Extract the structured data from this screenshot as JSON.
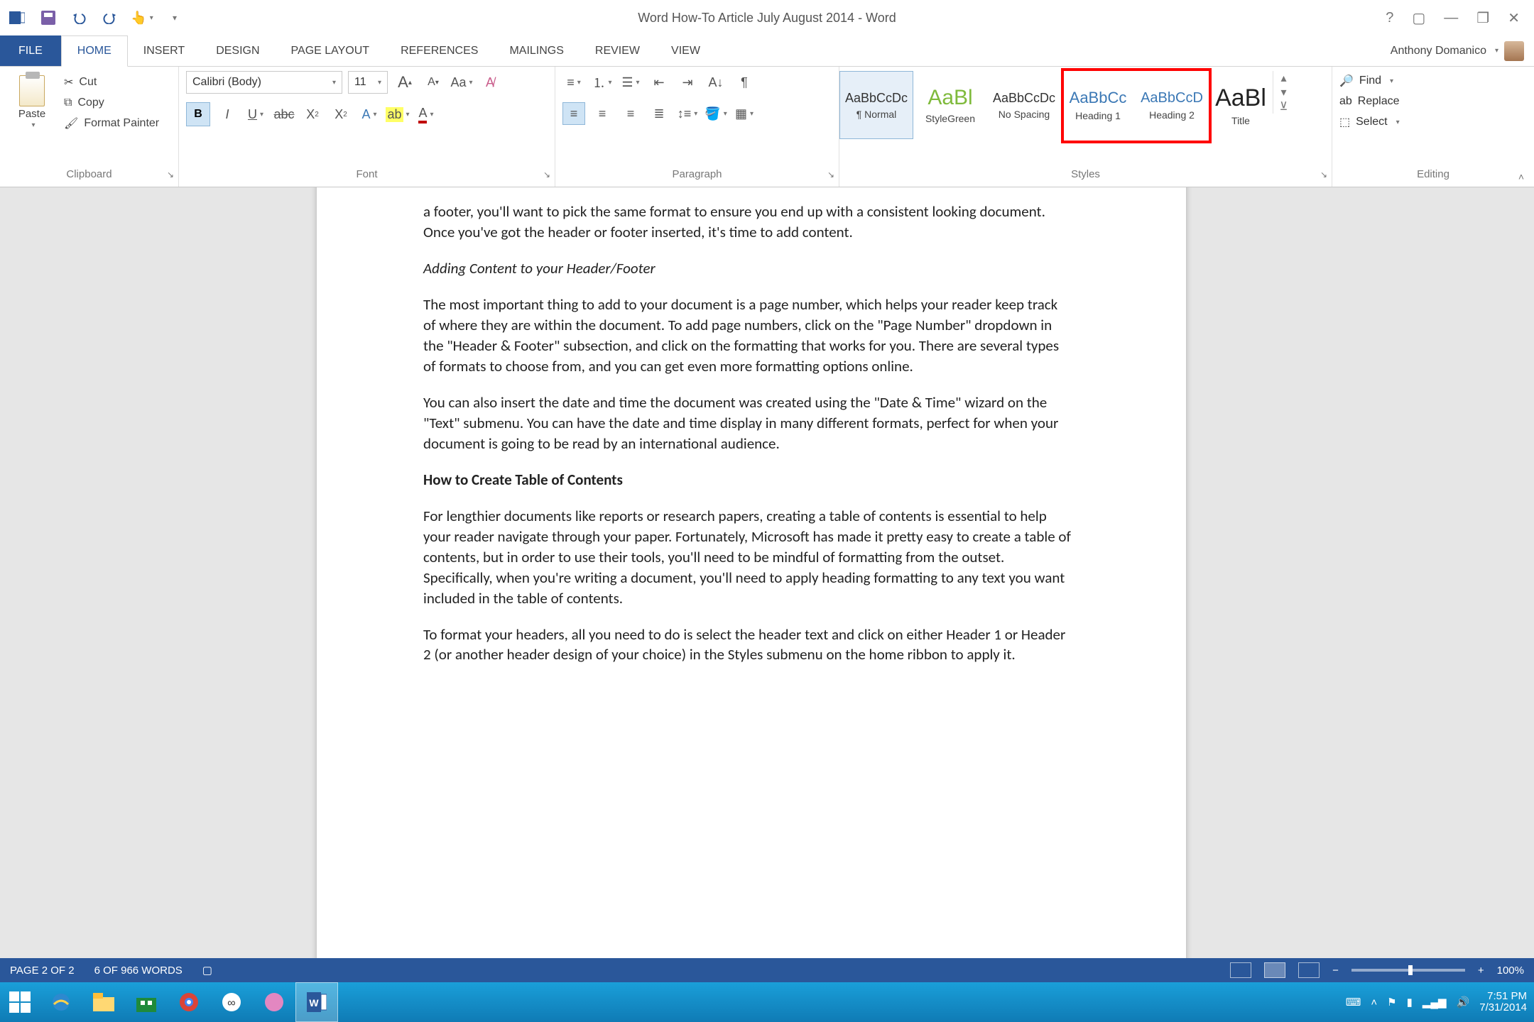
{
  "titlebar": {
    "document_title": "Word How-To Article July August 2014 - Word"
  },
  "tabs": {
    "file": "FILE",
    "items": [
      "HOME",
      "INSERT",
      "DESIGN",
      "PAGE LAYOUT",
      "REFERENCES",
      "MAILINGS",
      "REVIEW",
      "VIEW"
    ],
    "active_index": 0,
    "user_name": "Anthony Domanico"
  },
  "ribbon": {
    "clipboard": {
      "paste": "Paste",
      "cut": "Cut",
      "copy": "Copy",
      "format_painter": "Format Painter",
      "label": "Clipboard"
    },
    "font": {
      "name": "Calibri (Body)",
      "size": "11",
      "label": "Font"
    },
    "paragraph": {
      "label": "Paragraph"
    },
    "styles": {
      "label": "Styles",
      "items": [
        {
          "sample": "AaBbCcDc",
          "label": "¶ Normal",
          "color": "#333"
        },
        {
          "sample": "AaBl",
          "label": "StyleGreen",
          "color": "#7fba3c"
        },
        {
          "sample": "AaBbCcDc",
          "label": "No Spacing",
          "color": "#333"
        },
        {
          "sample": "AaBbCc",
          "label": "Heading 1",
          "color": "#3b78b5"
        },
        {
          "sample": "AaBbCcD",
          "label": "Heading 2",
          "color": "#3b78b5"
        },
        {
          "sample": "AaBl",
          "label": "Title",
          "color": "#222"
        }
      ]
    },
    "editing": {
      "find": "Find",
      "replace": "Replace",
      "select": "Select",
      "label": "Editing"
    }
  },
  "document": {
    "p1": "a footer, you'll want to pick the same format to ensure you end up with a consistent looking document. Once you've got the header or footer inserted, it's time to add content.",
    "p2": "Adding Content to your Header/Footer",
    "p3": "The most important thing to add to your document is a page number, which helps your reader keep track of where they are within the document. To add page numbers, click on the \"Page Number\" dropdown in the \"Header & Footer\" subsection, and click on the formatting that works for you. There are several types of formats to choose from, and you can get even more formatting options online.",
    "p4": "You can also insert the date and time the document was created using the \"Date & Time\" wizard on the \"Text\" submenu. You can have the date and time display in many different formats, perfect for when your document is going to be read by an international audience.",
    "p5": "How to Create Table of Contents",
    "p6": "For lengthier documents like reports or research papers, creating a table of contents is essential to help your reader navigate through your paper. Fortunately, Microsoft has made it pretty easy to create a table of contents, but in order to use their tools, you'll need to be mindful of formatting from the outset. Specifically, when you're writing a document, you'll need to apply heading formatting to any text you want included in the table of contents.",
    "p7": "To format your headers, all you need to do is select the header text and click on either Header 1 or Header 2 (or another header design of your choice) in the Styles submenu on the home ribbon to apply it."
  },
  "status": {
    "page": "PAGE 2 OF 2",
    "words": "6 OF 966 WORDS",
    "zoom": "100%"
  },
  "taskbar": {
    "time": "7:51 PM",
    "date": "7/31/2014"
  }
}
